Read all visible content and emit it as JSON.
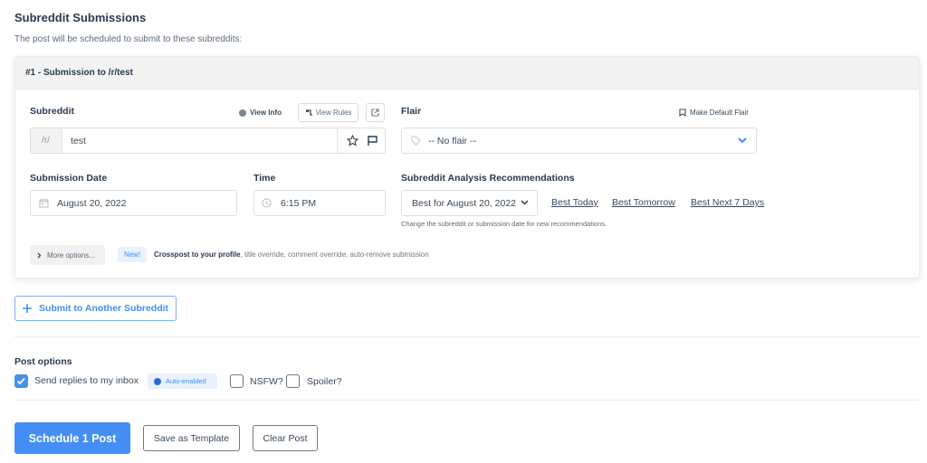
{
  "header": {
    "title": "Subreddit Submissions",
    "subtitle": "The post will be scheduled to submit to these subreddits:"
  },
  "submission": {
    "header": "#1 - Submission to /r/test",
    "subreddit": {
      "label": "Subreddit",
      "view_info": "View Info",
      "view_rules": "View Rules",
      "prefix": "/r/",
      "value": "test"
    },
    "flair": {
      "label": "Flair",
      "make_default": "Make Default Flair",
      "value": "-- No flair --"
    },
    "date": {
      "label": "Submission Date",
      "value": "August 20, 2022"
    },
    "time": {
      "label": "Time",
      "value": "6:15 PM"
    },
    "recommendations": {
      "label": "Subreddit Analysis Recommendations",
      "selected": "Best for August 20, 2022",
      "links": [
        "Best Today",
        "Best Tomorrow",
        "Best Next 7 Days"
      ],
      "hint": "Change the subreddit or submission date for new recommendations."
    },
    "more_options": {
      "button": "More options...",
      "badge": "New!",
      "bold_text": "Crosspost to your profile",
      "rest_text": ", title override, comment override, auto-remove submission"
    }
  },
  "add_subreddit_button": "Submit to Another Subreddit",
  "post_options": {
    "label": "Post options",
    "send_replies": {
      "label": "Send replies to my inbox",
      "checked": true,
      "badge": "Auto-enabled"
    },
    "nsfw": {
      "label": "NSFW?",
      "checked": false
    },
    "spoiler": {
      "label": "Spoiler?",
      "checked": false
    }
  },
  "actions": {
    "schedule": "Schedule 1 Post",
    "save_template": "Save as Template",
    "clear": "Clear Post"
  },
  "colors": {
    "primary": "#448ef6",
    "heading": "#283a4f",
    "badge_bg": "#e8f1fd"
  }
}
